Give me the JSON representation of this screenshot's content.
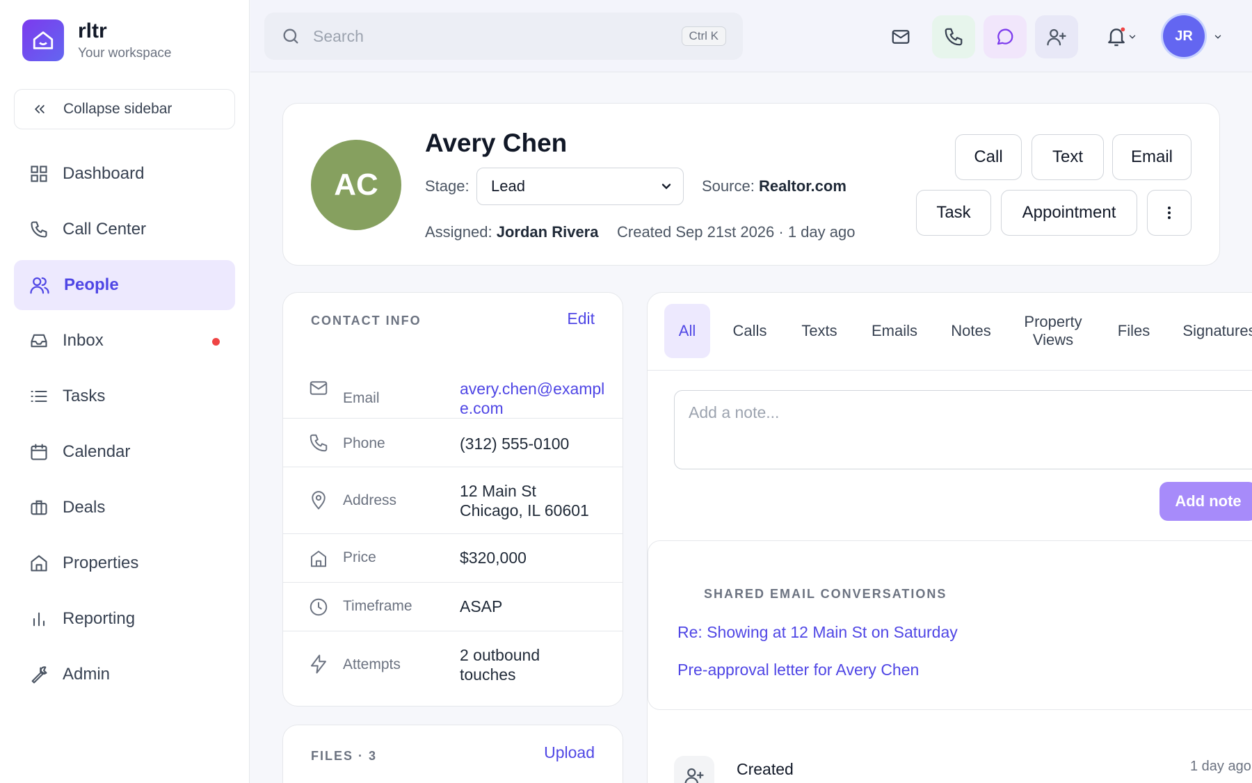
{
  "app": {
    "name": "rltr",
    "workspace": "Your workspace"
  },
  "sidebar": {
    "collapse_label": "Collapse sidebar",
    "items": [
      {
        "label": "Dashboard",
        "icon": "grid-icon"
      },
      {
        "label": "Call Center",
        "icon": "phone-icon"
      },
      {
        "label": "People",
        "icon": "users-icon",
        "active": true
      },
      {
        "label": "Inbox",
        "icon": "inbox-icon",
        "badge": true
      },
      {
        "label": "Tasks",
        "icon": "list-icon"
      },
      {
        "label": "Calendar",
        "icon": "calendar-icon"
      },
      {
        "label": "Deals",
        "icon": "briefcase-icon"
      },
      {
        "label": "Properties",
        "icon": "home-icon"
      },
      {
        "label": "Reporting",
        "icon": "bar-chart-icon"
      },
      {
        "label": "Admin",
        "icon": "wrench-icon"
      }
    ]
  },
  "topbar": {
    "search_placeholder": "Search",
    "shortcut": "Ctrl K",
    "user_initials": "JR"
  },
  "person": {
    "initials": "AC",
    "name": "Avery Chen",
    "stage_label": "Stage:",
    "stage": "Lead",
    "source_label": "Source:",
    "source": "Realtor.com",
    "assigned_label": "Assigned:",
    "assigned": "Jordan Rivera",
    "created": "Created Sep 21st 2026 · 1 day ago"
  },
  "actions": {
    "call": "Call",
    "text": "Text",
    "email": "Email",
    "task": "Task",
    "appointment": "Appointment"
  },
  "contact": {
    "title": "CONTACT INFO",
    "edit": "Edit",
    "rows": [
      {
        "label": "Email",
        "value": "avery.chen@example.com"
      },
      {
        "label": "Phone",
        "value": "(312) 555-0100"
      },
      {
        "label": "Address",
        "value": "12 Main St Chicago, IL 60601"
      },
      {
        "label": "Price",
        "value": "$320,000"
      },
      {
        "label": "Timeframe",
        "value": "ASAP"
      },
      {
        "label": "Attempts",
        "value": "2 outbound touches"
      }
    ]
  },
  "files": {
    "title": "FILES · 3",
    "upload": "Upload"
  },
  "activity": {
    "tabs": [
      "All",
      "Calls",
      "Texts",
      "Emails",
      "Notes",
      "Property Views",
      "Files",
      "Signatures"
    ],
    "note_placeholder": "Add a note...",
    "add_note": "Add note",
    "shared_title": "SHARED EMAIL CONVERSATIONS",
    "shared": [
      "Re: Showing at 12 Main St on Saturday",
      "Pre-approval letter for Avery Chen"
    ],
    "event_title": "Created",
    "event_time": "1 day ago"
  },
  "colors": {
    "accent": "#4f46e5",
    "accent_light": "#ede9fe",
    "avatar": "#86a05f",
    "badge": "#ef4444"
  }
}
